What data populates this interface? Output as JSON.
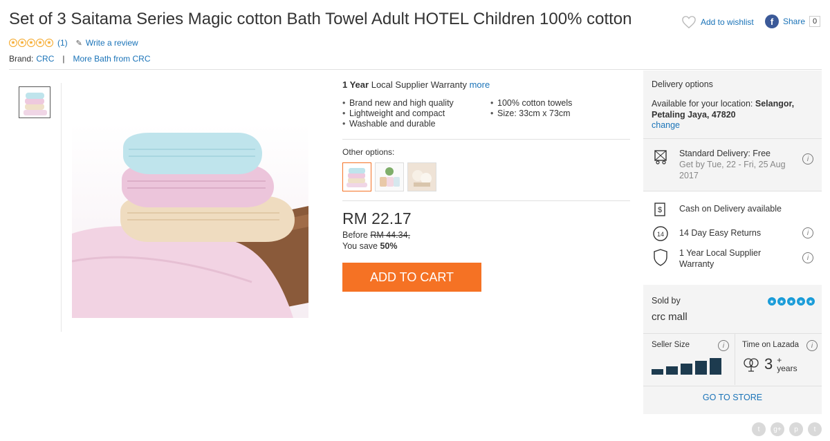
{
  "product": {
    "title": "Set of 3 Saitama Series Magic cotton Bath Towel Adult HOTEL Children 100% cotton",
    "rating_count": "(1)",
    "write_review": "Write a review",
    "brand_label": "Brand:",
    "brand_name": "CRC",
    "brand_separator": "|",
    "more_from": "More Bath from CRC"
  },
  "actions": {
    "wishlist": "Add to wishlist",
    "share": "Share",
    "share_count": "0"
  },
  "warranty": {
    "prefix": "1 Year",
    "text": "Local Supplier Warranty",
    "more": "more"
  },
  "features": [
    "Brand new and high quality",
    "100% cotton towels",
    "Lightweight and compact",
    "Size: 33cm x 73cm",
    "Washable and durable"
  ],
  "options": {
    "label": "Other options:"
  },
  "pricing": {
    "price": "RM 22.17",
    "before_label": "Before",
    "before_price": "RM 44.34,",
    "save_label": "You save",
    "save_percent": "50%",
    "add_to_cart": "ADD TO CART"
  },
  "delivery": {
    "title": "Delivery options",
    "location_label": "Available for your location:",
    "location": "Selangor, Petaling Jaya, 47820",
    "change": "change",
    "standard_title": "Standard Delivery: Free",
    "standard_eta": "Get by Tue, 22 - Fri, 25 Aug 2017",
    "cod": "Cash on Delivery available",
    "returns": "14 Day Easy Returns",
    "warranty": "1 Year Local Supplier Warranty"
  },
  "seller": {
    "sold_by": "Sold by",
    "name": "crc mall",
    "size_label": "Seller Size",
    "time_label": "Time on Lazada",
    "years_num": "3",
    "years_plus": "+",
    "years_unit": "years",
    "go_to_store": "GO TO STORE",
    "size_level": 5
  },
  "colors": {
    "accent": "#f57224",
    "link": "#1a73b8",
    "star": "#f5a623"
  }
}
